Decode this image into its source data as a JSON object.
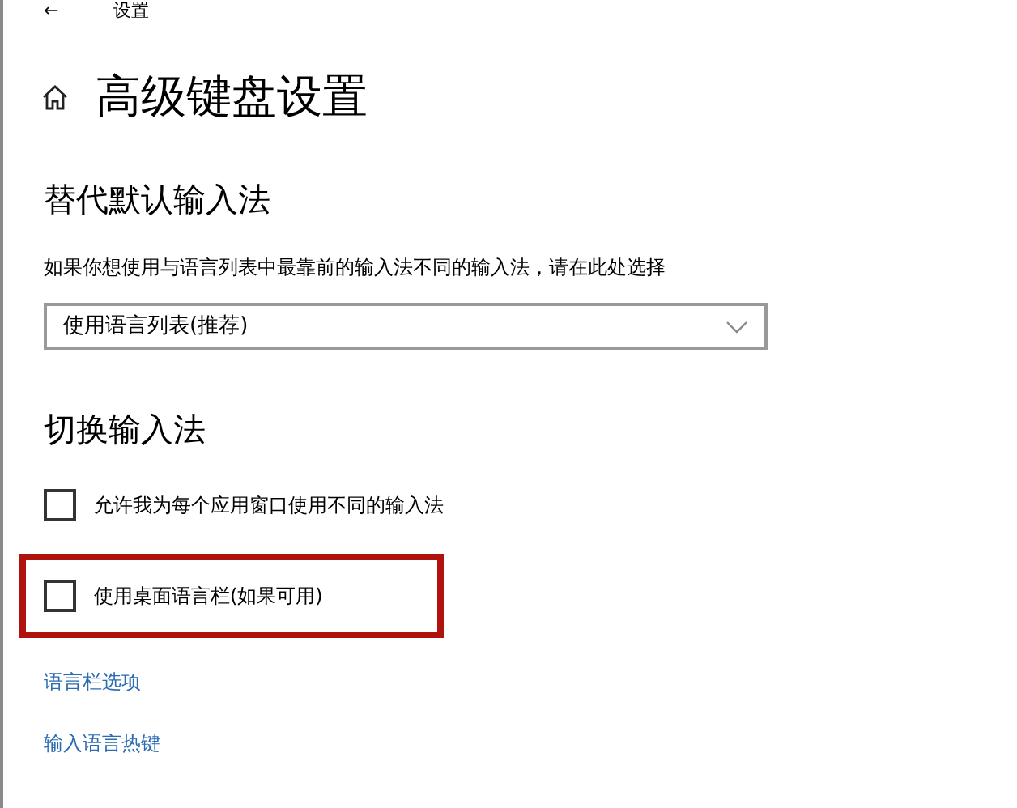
{
  "window": {
    "title": "设置",
    "back": "←"
  },
  "page": {
    "title": "高级键盘设置"
  },
  "sections": [
    {
      "heading": "替代默认输入法",
      "items": [
        {
          "kind": "text",
          "text": "如果你想使用与语言列表中最靠前的输入法不同的输入法，请在此处选择"
        },
        {
          "kind": "dropdown",
          "value": "使用语言列表(推荐)"
        }
      ]
    },
    {
      "heading": "切换输入法",
      "items": [
        {
          "kind": "checkbox",
          "label": "允许我为每个应用窗口使用不同的输入法",
          "checked": false,
          "highlighted": false
        },
        {
          "kind": "checkbox",
          "label": "使用桌面语言栏(如果可用)",
          "checked": false,
          "highlighted": true
        },
        {
          "kind": "link",
          "text": "语言栏选项"
        },
        {
          "kind": "link",
          "text": "输入语言热键"
        }
      ]
    }
  ]
}
